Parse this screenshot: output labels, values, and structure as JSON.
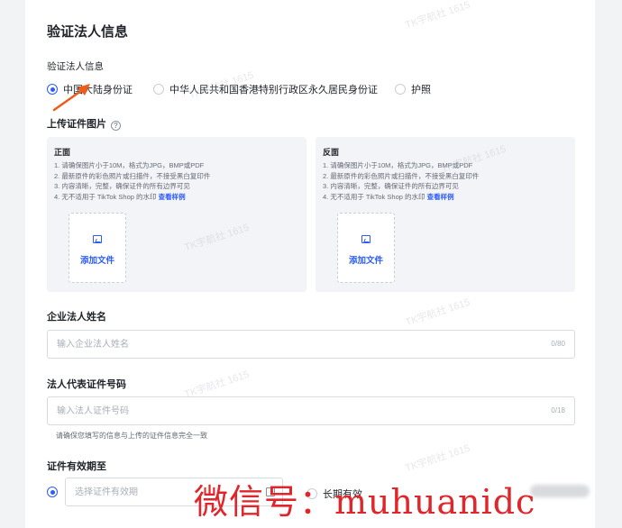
{
  "section_title": "验证法人信息",
  "id_type": {
    "label": "验证法人信息",
    "options": [
      {
        "label": "中国大陆身份证",
        "selected": true
      },
      {
        "label": "中华人民共和国香港特别行政区永久居民身份证",
        "selected": false
      },
      {
        "label": "护照",
        "selected": false
      }
    ]
  },
  "upload": {
    "label": "上传证件图片",
    "front": {
      "title": "正面",
      "requirements": [
        "1. 请确保图片小于10M，格式为JPG，BMP或PDF",
        "2. 最新原件的彩色照片或扫描件，不接受黑白复印件",
        "3. 内容清晰，完整，确保证件的所有边界可见",
        "4. 无不适用于 TikTok Shop 的水印"
      ],
      "example_link": "查看样例",
      "add_file": "添加文件"
    },
    "back": {
      "title": "反面",
      "requirements": [
        "1. 请确保图片小于10M，格式为JPG，BMP或PDF",
        "2. 最新原件的彩色照片或扫描件，不接受黑白复印件",
        "3. 内容清晰，完整，确保证件的所有边界可见",
        "4. 无不适用于 TikTok Shop 的水印"
      ],
      "example_link": "查看样例",
      "add_file": "添加文件"
    }
  },
  "legal_name": {
    "label": "企业法人姓名",
    "placeholder": "输入企业法人姓名",
    "counter": "0/80"
  },
  "id_number": {
    "label": "法人代表证件号码",
    "placeholder": "输入法人证件号码",
    "counter": "0/18",
    "note": "请确保您填写的信息与上传的证件信息完全一致"
  },
  "validity": {
    "label": "证件有效期至",
    "placeholder": "选择证件有效期",
    "long_term": "长期有效"
  },
  "watermark_text": "TK宇航社 1615",
  "overlay_text": "微信号：muhuanidc",
  "colors": {
    "accent": "#2d5bff",
    "annotation": "#f05a1a",
    "overlay": "#e0262b"
  }
}
